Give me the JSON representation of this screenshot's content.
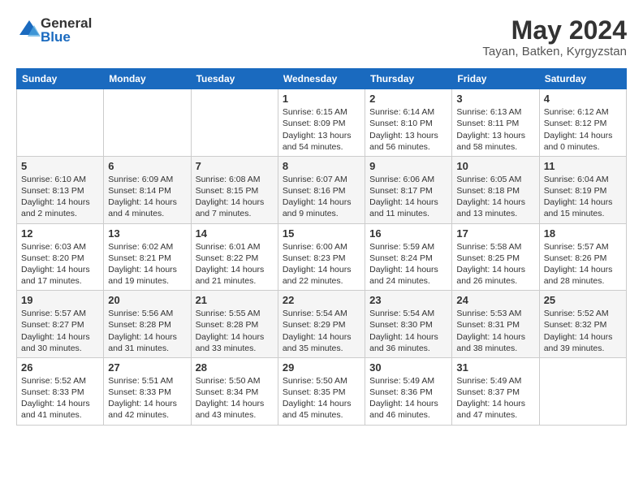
{
  "header": {
    "logo_general": "General",
    "logo_blue": "Blue",
    "title": "May 2024",
    "subtitle": "Tayan, Batken, Kyrgyzstan"
  },
  "weekdays": [
    "Sunday",
    "Monday",
    "Tuesday",
    "Wednesday",
    "Thursday",
    "Friday",
    "Saturday"
  ],
  "weeks": [
    [
      {
        "day": "",
        "info": ""
      },
      {
        "day": "",
        "info": ""
      },
      {
        "day": "",
        "info": ""
      },
      {
        "day": "1",
        "info": "Sunrise: 6:15 AM\nSunset: 8:09 PM\nDaylight: 13 hours\nand 54 minutes."
      },
      {
        "day": "2",
        "info": "Sunrise: 6:14 AM\nSunset: 8:10 PM\nDaylight: 13 hours\nand 56 minutes."
      },
      {
        "day": "3",
        "info": "Sunrise: 6:13 AM\nSunset: 8:11 PM\nDaylight: 13 hours\nand 58 minutes."
      },
      {
        "day": "4",
        "info": "Sunrise: 6:12 AM\nSunset: 8:12 PM\nDaylight: 14 hours\nand 0 minutes."
      }
    ],
    [
      {
        "day": "5",
        "info": "Sunrise: 6:10 AM\nSunset: 8:13 PM\nDaylight: 14 hours\nand 2 minutes."
      },
      {
        "day": "6",
        "info": "Sunrise: 6:09 AM\nSunset: 8:14 PM\nDaylight: 14 hours\nand 4 minutes."
      },
      {
        "day": "7",
        "info": "Sunrise: 6:08 AM\nSunset: 8:15 PM\nDaylight: 14 hours\nand 7 minutes."
      },
      {
        "day": "8",
        "info": "Sunrise: 6:07 AM\nSunset: 8:16 PM\nDaylight: 14 hours\nand 9 minutes."
      },
      {
        "day": "9",
        "info": "Sunrise: 6:06 AM\nSunset: 8:17 PM\nDaylight: 14 hours\nand 11 minutes."
      },
      {
        "day": "10",
        "info": "Sunrise: 6:05 AM\nSunset: 8:18 PM\nDaylight: 14 hours\nand 13 minutes."
      },
      {
        "day": "11",
        "info": "Sunrise: 6:04 AM\nSunset: 8:19 PM\nDaylight: 14 hours\nand 15 minutes."
      }
    ],
    [
      {
        "day": "12",
        "info": "Sunrise: 6:03 AM\nSunset: 8:20 PM\nDaylight: 14 hours\nand 17 minutes."
      },
      {
        "day": "13",
        "info": "Sunrise: 6:02 AM\nSunset: 8:21 PM\nDaylight: 14 hours\nand 19 minutes."
      },
      {
        "day": "14",
        "info": "Sunrise: 6:01 AM\nSunset: 8:22 PM\nDaylight: 14 hours\nand 21 minutes."
      },
      {
        "day": "15",
        "info": "Sunrise: 6:00 AM\nSunset: 8:23 PM\nDaylight: 14 hours\nand 22 minutes."
      },
      {
        "day": "16",
        "info": "Sunrise: 5:59 AM\nSunset: 8:24 PM\nDaylight: 14 hours\nand 24 minutes."
      },
      {
        "day": "17",
        "info": "Sunrise: 5:58 AM\nSunset: 8:25 PM\nDaylight: 14 hours\nand 26 minutes."
      },
      {
        "day": "18",
        "info": "Sunrise: 5:57 AM\nSunset: 8:26 PM\nDaylight: 14 hours\nand 28 minutes."
      }
    ],
    [
      {
        "day": "19",
        "info": "Sunrise: 5:57 AM\nSunset: 8:27 PM\nDaylight: 14 hours\nand 30 minutes."
      },
      {
        "day": "20",
        "info": "Sunrise: 5:56 AM\nSunset: 8:28 PM\nDaylight: 14 hours\nand 31 minutes."
      },
      {
        "day": "21",
        "info": "Sunrise: 5:55 AM\nSunset: 8:28 PM\nDaylight: 14 hours\nand 33 minutes."
      },
      {
        "day": "22",
        "info": "Sunrise: 5:54 AM\nSunset: 8:29 PM\nDaylight: 14 hours\nand 35 minutes."
      },
      {
        "day": "23",
        "info": "Sunrise: 5:54 AM\nSunset: 8:30 PM\nDaylight: 14 hours\nand 36 minutes."
      },
      {
        "day": "24",
        "info": "Sunrise: 5:53 AM\nSunset: 8:31 PM\nDaylight: 14 hours\nand 38 minutes."
      },
      {
        "day": "25",
        "info": "Sunrise: 5:52 AM\nSunset: 8:32 PM\nDaylight: 14 hours\nand 39 minutes."
      }
    ],
    [
      {
        "day": "26",
        "info": "Sunrise: 5:52 AM\nSunset: 8:33 PM\nDaylight: 14 hours\nand 41 minutes."
      },
      {
        "day": "27",
        "info": "Sunrise: 5:51 AM\nSunset: 8:33 PM\nDaylight: 14 hours\nand 42 minutes."
      },
      {
        "day": "28",
        "info": "Sunrise: 5:50 AM\nSunset: 8:34 PM\nDaylight: 14 hours\nand 43 minutes."
      },
      {
        "day": "29",
        "info": "Sunrise: 5:50 AM\nSunset: 8:35 PM\nDaylight: 14 hours\nand 45 minutes."
      },
      {
        "day": "30",
        "info": "Sunrise: 5:49 AM\nSunset: 8:36 PM\nDaylight: 14 hours\nand 46 minutes."
      },
      {
        "day": "31",
        "info": "Sunrise: 5:49 AM\nSunset: 8:37 PM\nDaylight: 14 hours\nand 47 minutes."
      },
      {
        "day": "",
        "info": ""
      }
    ]
  ]
}
